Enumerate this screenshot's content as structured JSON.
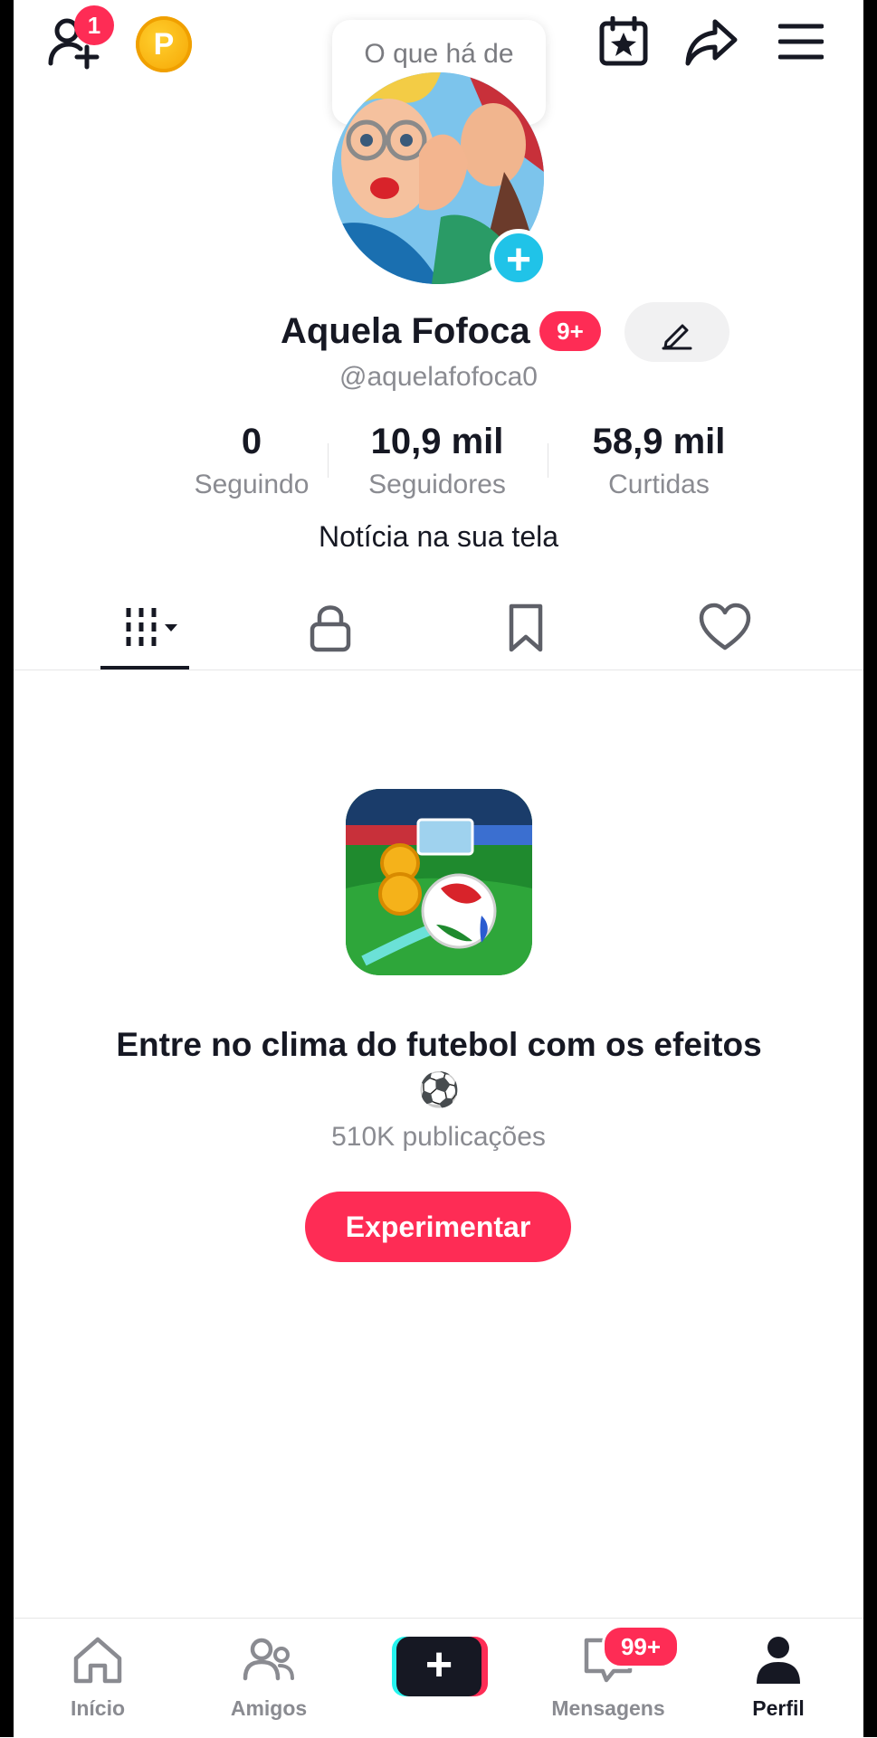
{
  "top_bar": {
    "add_friend_badge": "1",
    "coin_letter": "P",
    "bubble_text": "O que há de bom?"
  },
  "profile": {
    "name": "Aquela Fofoca",
    "name_badge": "9+",
    "handle": "@aquelafofoca0",
    "stats": [
      {
        "value": "0",
        "label": "Seguindo"
      },
      {
        "value": "10,9 mil",
        "label": "Seguidores"
      },
      {
        "value": "58,9 mil",
        "label": "Curtidas"
      }
    ],
    "bio": "Notícia na sua tela"
  },
  "tabs": [
    "videos-grid-icon",
    "lock-icon",
    "bookmark-icon",
    "heart-icon"
  ],
  "promo": {
    "title": "Entre no clima do futebol com os efeitos ⚽",
    "count": "510K publicações",
    "button": "Experimentar"
  },
  "bottom_nav": {
    "items": [
      {
        "label": "Início",
        "icon": "home-icon"
      },
      {
        "label": "Amigos",
        "icon": "friends-icon"
      },
      {
        "label": "",
        "icon": "create-icon"
      },
      {
        "label": "Mensagens",
        "icon": "inbox-icon"
      },
      {
        "label": "Perfil",
        "icon": "profile-icon"
      }
    ],
    "messages_badge": "99+"
  },
  "colors": {
    "accent": "#fe2c55",
    "cyan": "#25f4ee",
    "text": "#161823",
    "muted": "#8a8b91"
  }
}
